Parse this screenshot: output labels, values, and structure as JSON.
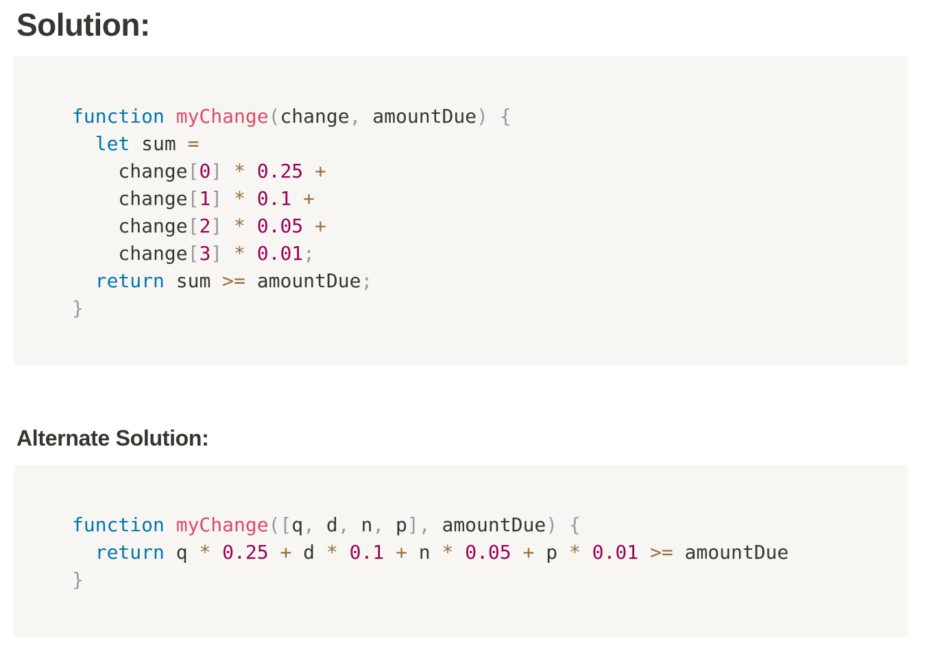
{
  "headings": {
    "solution": "Solution:",
    "alternate": "Alternate Solution:"
  },
  "colors": {
    "keyword": "#0077aa",
    "function_name": "#dd4a68",
    "punctuation": "#999999",
    "operator": "#9a6e3a",
    "number": "#990055",
    "text": "#37352f",
    "code_background": "#f7f6f3"
  },
  "code_blocks": [
    {
      "language": "javascript",
      "lines": [
        [
          [
            "kw",
            "function"
          ],
          [
            "tx",
            " "
          ],
          [
            "fn",
            "myChange"
          ],
          [
            "pn",
            "("
          ],
          [
            "tx",
            "change"
          ],
          [
            "pn",
            ","
          ],
          [
            "tx",
            " amountDue"
          ],
          [
            "pn",
            ")"
          ],
          [
            "tx",
            " "
          ],
          [
            "pn",
            "{"
          ]
        ],
        [
          [
            "tx",
            "  "
          ],
          [
            "kw",
            "let"
          ],
          [
            "tx",
            " sum "
          ],
          [
            "op",
            "="
          ]
        ],
        [
          [
            "tx",
            "    change"
          ],
          [
            "pn",
            "["
          ],
          [
            "nm",
            "0"
          ],
          [
            "pn",
            "]"
          ],
          [
            "tx",
            " "
          ],
          [
            "op",
            "*"
          ],
          [
            "tx",
            " "
          ],
          [
            "nm",
            "0.25"
          ],
          [
            "tx",
            " "
          ],
          [
            "op",
            "+"
          ]
        ],
        [
          [
            "tx",
            "    change"
          ],
          [
            "pn",
            "["
          ],
          [
            "nm",
            "1"
          ],
          [
            "pn",
            "]"
          ],
          [
            "tx",
            " "
          ],
          [
            "op",
            "*"
          ],
          [
            "tx",
            " "
          ],
          [
            "nm",
            "0.1"
          ],
          [
            "tx",
            " "
          ],
          [
            "op",
            "+"
          ]
        ],
        [
          [
            "tx",
            "    change"
          ],
          [
            "pn",
            "["
          ],
          [
            "nm",
            "2"
          ],
          [
            "pn",
            "]"
          ],
          [
            "tx",
            " "
          ],
          [
            "op",
            "*"
          ],
          [
            "tx",
            " "
          ],
          [
            "nm",
            "0.05"
          ],
          [
            "tx",
            " "
          ],
          [
            "op",
            "+"
          ]
        ],
        [
          [
            "tx",
            "    change"
          ],
          [
            "pn",
            "["
          ],
          [
            "nm",
            "3"
          ],
          [
            "pn",
            "]"
          ],
          [
            "tx",
            " "
          ],
          [
            "op",
            "*"
          ],
          [
            "tx",
            " "
          ],
          [
            "nm",
            "0.01"
          ],
          [
            "pn",
            ";"
          ]
        ],
        [
          [
            "tx",
            "  "
          ],
          [
            "kw",
            "return"
          ],
          [
            "tx",
            " sum "
          ],
          [
            "op",
            ">="
          ],
          [
            "tx",
            " amountDue"
          ],
          [
            "pn",
            ";"
          ]
        ],
        [
          [
            "pn",
            "}"
          ]
        ]
      ]
    },
    {
      "language": "javascript",
      "lines": [
        [
          [
            "kw",
            "function"
          ],
          [
            "tx",
            " "
          ],
          [
            "fn",
            "myChange"
          ],
          [
            "pn",
            "(["
          ],
          [
            "tx",
            "q"
          ],
          [
            "pn",
            ","
          ],
          [
            "tx",
            " d"
          ],
          [
            "pn",
            ","
          ],
          [
            "tx",
            " n"
          ],
          [
            "pn",
            ","
          ],
          [
            "tx",
            " p"
          ],
          [
            "pn",
            "],"
          ],
          [
            "tx",
            " amountDue"
          ],
          [
            "pn",
            ")"
          ],
          [
            "tx",
            " "
          ],
          [
            "pn",
            "{"
          ]
        ],
        [
          [
            "tx",
            "  "
          ],
          [
            "kw",
            "return"
          ],
          [
            "tx",
            " q "
          ],
          [
            "op",
            "*"
          ],
          [
            "tx",
            " "
          ],
          [
            "nm",
            "0.25"
          ],
          [
            "tx",
            " "
          ],
          [
            "op",
            "+"
          ],
          [
            "tx",
            " d "
          ],
          [
            "op",
            "*"
          ],
          [
            "tx",
            " "
          ],
          [
            "nm",
            "0.1"
          ],
          [
            "tx",
            " "
          ],
          [
            "op",
            "+"
          ],
          [
            "tx",
            " n "
          ],
          [
            "op",
            "*"
          ],
          [
            "tx",
            " "
          ],
          [
            "nm",
            "0.05"
          ],
          [
            "tx",
            " "
          ],
          [
            "op",
            "+"
          ],
          [
            "tx",
            " p "
          ],
          [
            "op",
            "*"
          ],
          [
            "tx",
            " "
          ],
          [
            "nm",
            "0.01"
          ],
          [
            "tx",
            " "
          ],
          [
            "op",
            ">="
          ],
          [
            "tx",
            " amountDue"
          ]
        ],
        [
          [
            "pn",
            "}"
          ]
        ]
      ]
    }
  ]
}
